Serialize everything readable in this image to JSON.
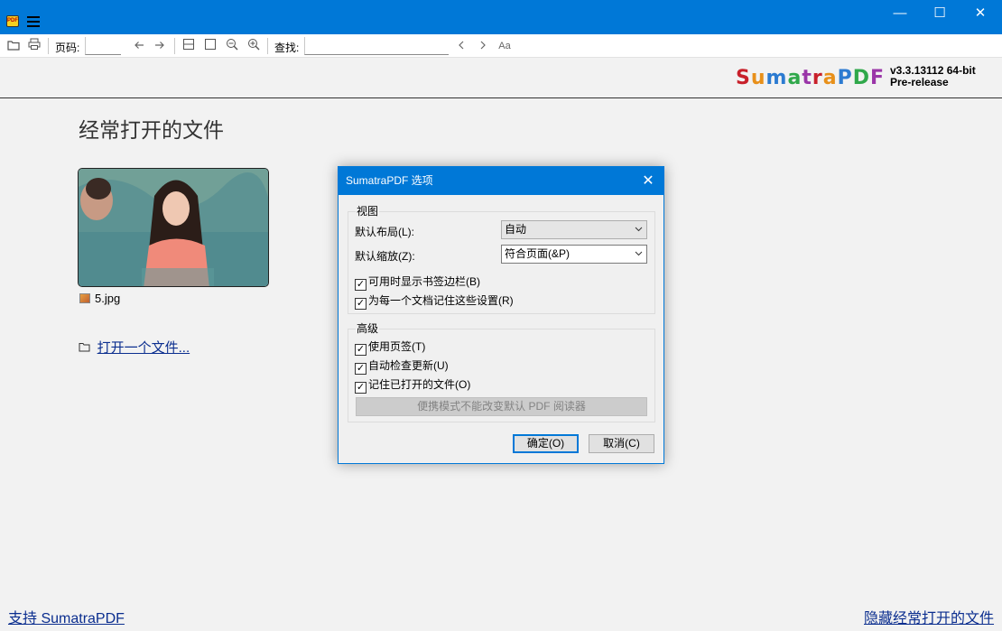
{
  "window": {
    "minimize_glyph": "—",
    "maximize_glyph": "☐",
    "close_glyph": "✕"
  },
  "toolbar": {
    "page_label": "页码:",
    "find_label": "查找:",
    "icons": [
      "folder-icon",
      "print-icon",
      "back-arrow-icon",
      "forward-arrow-icon",
      "fit-page-icon",
      "fit-width-icon",
      "zoom-out-icon",
      "zoom-in-icon",
      "find-prev-icon",
      "find-next-icon",
      "match-case-icon"
    ]
  },
  "header": {
    "logo_text": "SumatraPDF",
    "version_line1": "v3.3.13112 64-bit",
    "version_line2": "Pre-release",
    "logo_colors": [
      "#c8202a",
      "#e8901a",
      "#2c7bd1",
      "#2fa84a",
      "#9a35a8"
    ]
  },
  "main": {
    "title": "经常打开的文件",
    "recent_files": [
      {
        "name": "5.jpg"
      }
    ],
    "open_file_link": "打开一个文件...",
    "support_link": "支持 SumatraPDF",
    "hide_link": "隐藏经常打开的文件"
  },
  "dialog": {
    "title": "SumatraPDF 选项",
    "view_group": {
      "label": "视图",
      "layout_label": "默认布局(L):",
      "layout_value": "自动",
      "zoom_label": "默认缩放(Z):",
      "zoom_value": "符合页面(&P)",
      "checks": [
        {
          "label": "可用时显示书签边栏(B)",
          "checked": true
        },
        {
          "label": "为每一个文档记住这些设置(R)",
          "checked": true
        }
      ]
    },
    "advanced_group": {
      "label": "高级",
      "checks": [
        {
          "label": "使用页签(T)",
          "checked": true
        },
        {
          "label": "自动检查更新(U)",
          "checked": true
        },
        {
          "label": "记住已打开的文件(O)",
          "checked": true
        }
      ],
      "disabled_button": "便携模式不能改变默认 PDF 阅读器"
    },
    "ok_button": "确定(O)",
    "cancel_button": "取消(C)",
    "check_glyph": "✓"
  }
}
